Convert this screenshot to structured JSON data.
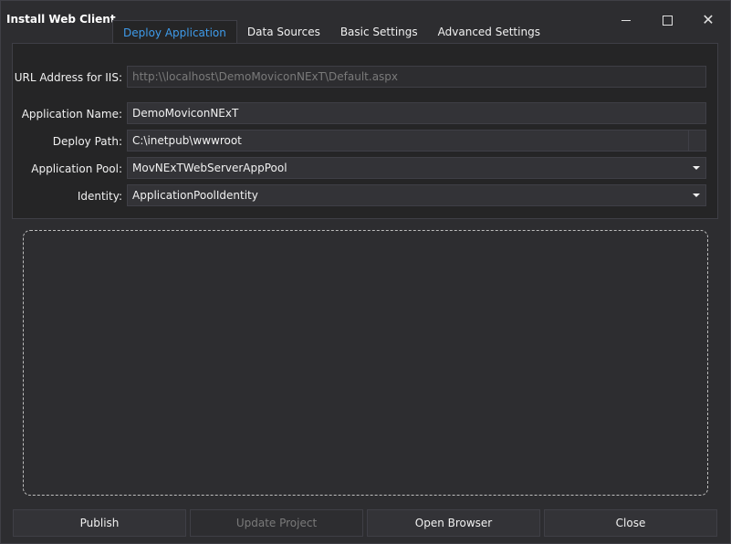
{
  "window": {
    "title": "Install Web Client",
    "controls": {
      "minimize": "minimize-icon",
      "maximize": "maximize-icon",
      "close": "close-icon"
    }
  },
  "tabs": [
    {
      "label": "Deploy Application",
      "active": true
    },
    {
      "label": "Data Sources",
      "active": false
    },
    {
      "label": "Basic Settings",
      "active": false
    },
    {
      "label": "Advanced Settings",
      "active": false
    }
  ],
  "form": {
    "url": {
      "label": "URL Address for IIS:",
      "value": "http:\\\\localhost\\DemoMoviconNExT\\Default.aspx"
    },
    "app_name": {
      "label": "Application Name:",
      "value": "DemoMoviconNExT"
    },
    "deploy_path": {
      "label": "Deploy Path:",
      "value": "C:\\inetpub\\wwwroot"
    },
    "app_pool": {
      "label": "Application Pool:",
      "value": "MovNExTWebServerAppPool"
    },
    "identity": {
      "label": "Identity:",
      "value": "ApplicationPoolIdentity"
    }
  },
  "buttons": {
    "publish": "Publish",
    "update_project": "Update Project",
    "open_browser": "Open Browser",
    "close": "Close"
  },
  "colors": {
    "background": "#2d2d30",
    "panel": "#252526",
    "accent": "#3e9bea",
    "border": "#3f3f46"
  }
}
